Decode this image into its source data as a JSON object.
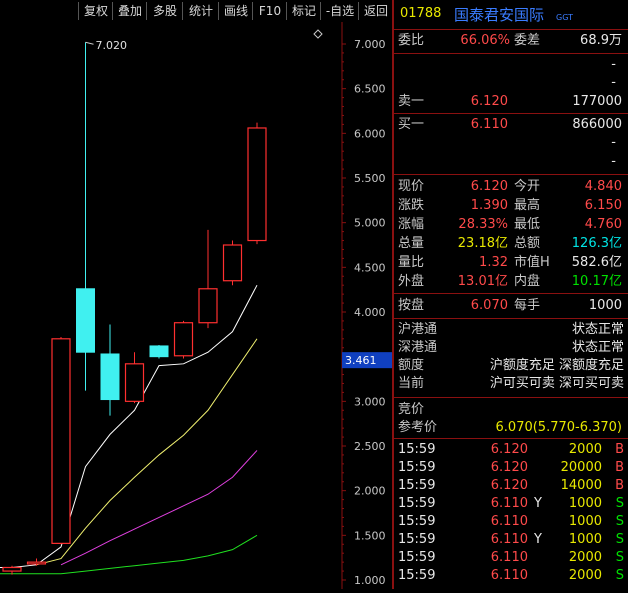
{
  "toolbar": [
    "复权",
    "叠加",
    "多股",
    "统计",
    "画线",
    "F10",
    "标记",
    "-自选",
    "返回"
  ],
  "chart_data": {
    "type": "candlestick",
    "y_ticks": [
      "7.000",
      "6.500",
      "6.000",
      "5.500",
      "5.000",
      "4.500",
      "4.000",
      "3.500",
      "3.000",
      "2.500",
      "2.000",
      "1.500",
      "1.000"
    ],
    "ylim": [
      1.0,
      7.0
    ],
    "high_label": "7.020",
    "cursor_label": "3.461",
    "candles": [
      {
        "open": 1.1,
        "close": 1.14,
        "high": 1.16,
        "low": 1.06,
        "color": "red"
      },
      {
        "open": 1.18,
        "close": 1.2,
        "high": 1.24,
        "low": 1.16,
        "color": "red"
      },
      {
        "open": 1.41,
        "close": 3.7,
        "high": 3.72,
        "low": 1.4,
        "color": "red"
      },
      {
        "open": 4.26,
        "close": 3.55,
        "high": 7.02,
        "low": 3.12,
        "color": "cyan"
      },
      {
        "open": 3.53,
        "close": 3.02,
        "high": 3.86,
        "low": 2.84,
        "color": "cyan"
      },
      {
        "open": 3.0,
        "close": 3.42,
        "high": 3.55,
        "low": 2.98,
        "color": "red"
      },
      {
        "open": 3.62,
        "close": 3.5,
        "high": 3.63,
        "low": 3.48,
        "color": "cyan"
      },
      {
        "open": 3.51,
        "close": 3.88,
        "high": 3.9,
        "low": 3.48,
        "color": "red"
      },
      {
        "open": 3.88,
        "close": 4.26,
        "high": 4.92,
        "low": 3.82,
        "color": "red"
      },
      {
        "open": 4.35,
        "close": 4.75,
        "high": 4.8,
        "low": 4.3,
        "color": "red"
      },
      {
        "open": 4.8,
        "close": 6.06,
        "high": 6.12,
        "low": 4.76,
        "color": "red"
      }
    ],
    "series": [
      {
        "color": "#ffffff",
        "values": [
          1.14,
          1.17,
          1.37,
          2.27,
          2.63,
          2.9,
          3.4,
          3.42,
          3.55,
          3.78,
          4.3
        ]
      },
      {
        "color": "#f0f070",
        "values": [
          null,
          1.17,
          1.24,
          1.58,
          1.89,
          2.15,
          2.4,
          2.62,
          2.9,
          3.3,
          3.7
        ]
      },
      {
        "color": "#e040e0",
        "values": [
          null,
          null,
          1.17,
          1.3,
          1.44,
          1.57,
          1.7,
          1.83,
          1.96,
          2.15,
          2.45
        ]
      },
      {
        "color": "#20e020",
        "values": [
          null,
          null,
          1.07,
          1.1,
          1.13,
          1.16,
          1.19,
          1.22,
          1.27,
          1.34,
          1.5
        ]
      }
    ],
    "extra_green_start": 1.07
  },
  "panel": {
    "code": "01788",
    "name": "国泰君安国际",
    "tag": "GGT",
    "weibi_label": "委比",
    "weibi": "66.06%",
    "weicha_label": "委差",
    "weicha": "68.9万",
    "dash": "-",
    "sell1_label": "卖一",
    "sell1_price": "6.120",
    "sell1_vol": "177000",
    "buy1_label": "买一",
    "buy1_price": "6.110",
    "buy1_vol": "866000",
    "stats": [
      {
        "l1": "现价",
        "v1": "6.120",
        "c1": "red",
        "l2": "今开",
        "v2": "4.840",
        "c2": "red"
      },
      {
        "l1": "涨跌",
        "v1": "1.390",
        "c1": "red",
        "l2": "最高",
        "v2": "6.150",
        "c2": "red"
      },
      {
        "l1": "涨幅",
        "v1": "28.33%",
        "c1": "red",
        "l2": "最低",
        "v2": "4.760",
        "c2": "red"
      },
      {
        "l1": "总量",
        "v1": "23.18亿",
        "c1": "yellow",
        "l2": "总额",
        "v2": "126.3亿",
        "c2": "cyan"
      },
      {
        "l1": "量比",
        "v1": "1.32",
        "c1": "red",
        "l2": "市值H",
        "v2": "582.6亿",
        "c2": "white"
      },
      {
        "l1": "外盘",
        "v1": "13.01亿",
        "c1": "red",
        "l2": "内盘",
        "v2": "10.17亿",
        "c2": "green"
      }
    ],
    "anpan_label": "按盘",
    "anpan": "6.070",
    "meishou_label": "每手",
    "meishou": "1000",
    "hk": [
      {
        "l": "沪港通",
        "v": "状态正常"
      },
      {
        "l": "深港通",
        "v": "状态正常"
      },
      {
        "l": "额度",
        "v": "沪额度充足 深额度充足"
      },
      {
        "l": "当前",
        "v": "沪可买可卖 深可买可卖"
      }
    ],
    "jingjia_label": "竞价",
    "ref_label": "参考价",
    "ref_value": "6.070(5.770-6.370)",
    "ticks": [
      {
        "t": "15:59",
        "p": "6.120",
        "f": "",
        "v": "2000",
        "s": "B"
      },
      {
        "t": "15:59",
        "p": "6.120",
        "f": "",
        "v": "20000",
        "s": "B"
      },
      {
        "t": "15:59",
        "p": "6.120",
        "f": "",
        "v": "14000",
        "s": "B"
      },
      {
        "t": "15:59",
        "p": "6.110",
        "f": "Y",
        "v": "1000",
        "s": "S"
      },
      {
        "t": "15:59",
        "p": "6.110",
        "f": "",
        "v": "1000",
        "s": "S"
      },
      {
        "t": "15:59",
        "p": "6.110",
        "f": "Y",
        "v": "1000",
        "s": "S"
      },
      {
        "t": "15:59",
        "p": "6.110",
        "f": "",
        "v": "2000",
        "s": "S"
      },
      {
        "t": "15:59",
        "p": "6.110",
        "f": "",
        "v": "2000",
        "s": "S"
      }
    ]
  }
}
